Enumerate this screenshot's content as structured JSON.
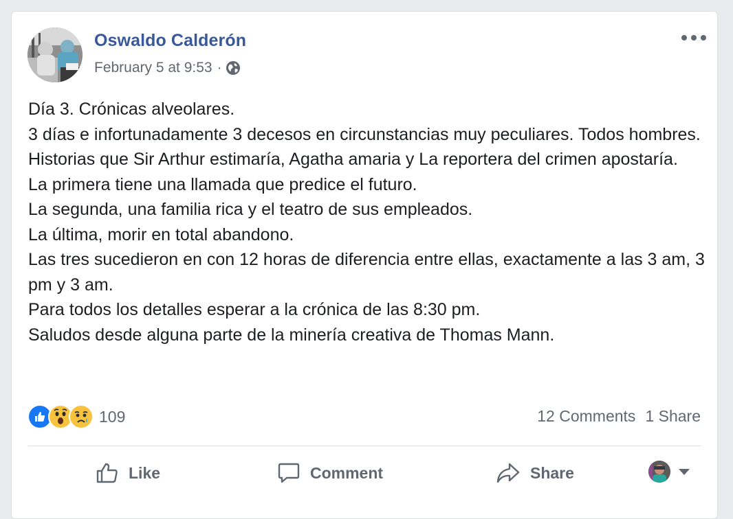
{
  "post": {
    "author": "Oswaldo Calderón",
    "timestamp": "February 5 at 9:53",
    "separator": "·",
    "privacy_icon": "globe-icon",
    "body_lines": [
      "Día 3. Crónicas alveolares.",
      "3 días e infortunadamente 3 decesos en circunstancias muy peculiares. Todos hombres. Historias que Sir Arthur estimaría, Agatha amaria y La reportera del crimen apostaría.",
      "La primera tiene una llamada que predice el futuro.",
      "La segunda, una familia rica y el teatro de sus empleados.",
      "La última, morir en total abandono.",
      "Las tres sucedieron en con 12 horas de diferencia entre ellas, exactamente a las 3 am, 3 pm y 3 am.",
      "Para todos los detalles esperar a la crónica de las 8:30 pm.",
      "Saludos desde alguna parte de la minería creativa de Thomas Mann."
    ]
  },
  "reactions": {
    "icons": [
      "like-reaction-icon",
      "wow-reaction-icon",
      "sad-reaction-icon"
    ],
    "count": "109"
  },
  "stats": {
    "comments": "12 Comments",
    "shares": "1 Share"
  },
  "actions": {
    "like": "Like",
    "comment": "Comment",
    "share": "Share"
  },
  "colors": {
    "author_link": "#385898",
    "secondary_text": "#606770",
    "like_blue": "#1877f2",
    "reaction_yellow": "#f7c23e"
  }
}
